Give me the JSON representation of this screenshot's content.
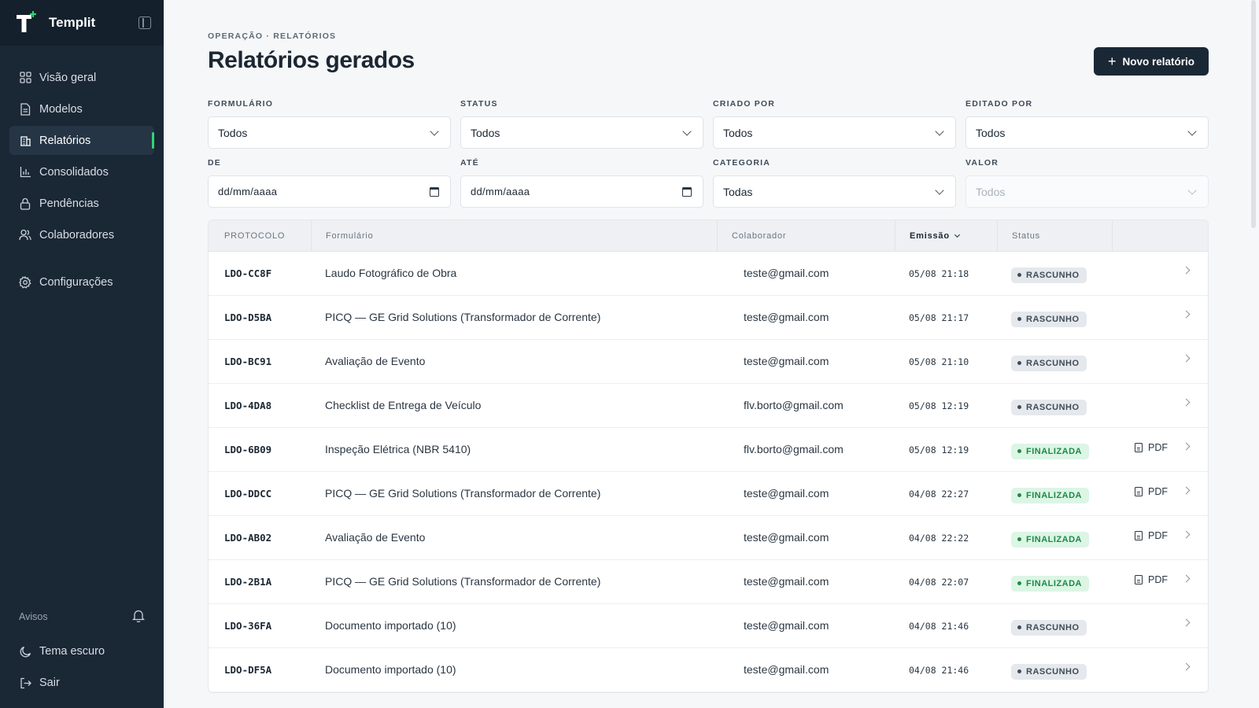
{
  "app": {
    "name": "Templit"
  },
  "sidebar": {
    "items": [
      {
        "label": "Visão geral",
        "icon": "grid-icon"
      },
      {
        "label": "Modelos",
        "icon": "document-icon"
      },
      {
        "label": "Relatórios",
        "icon": "building-icon",
        "active": true
      },
      {
        "label": "Consolidados",
        "icon": "bar-chart-icon"
      },
      {
        "label": "Pendências",
        "icon": "lock-icon"
      },
      {
        "label": "Colaboradores",
        "icon": "users-icon"
      },
      {
        "label": "Configurações",
        "icon": "gear-icon"
      }
    ],
    "avisos_label": "Avisos",
    "dark_theme_label": "Tema escuro",
    "logout_label": "Sair"
  },
  "header": {
    "breadcrumb": "OPERAÇÃO · RELATÓRIOS",
    "title": "Relatórios gerados",
    "new_button": "Novo relatório"
  },
  "filters": {
    "formulario": {
      "label": "FORMULÁRIO",
      "value": "Todos"
    },
    "status": {
      "label": "STATUS",
      "value": "Todos"
    },
    "criado_por": {
      "label": "CRIADO POR",
      "value": "Todos"
    },
    "editado_por": {
      "label": "EDITADO POR",
      "value": "Todos"
    },
    "de": {
      "label": "DE",
      "value": "dd/mm/aaaa"
    },
    "ate": {
      "label": "ATÉ",
      "value": "dd/mm/aaaa"
    },
    "categoria": {
      "label": "CATEGORIA",
      "value": "Todas"
    },
    "valor": {
      "label": "VALOR",
      "value": "Todos",
      "disabled": true
    }
  },
  "table": {
    "columns": {
      "protocolo": "PROTOCOLO",
      "formulario": "Formulário",
      "colaborador": "Colaborador",
      "emissao": "Emissão",
      "status": "Status"
    },
    "pdf_label": "PDF",
    "rows": [
      {
        "protocolo": "LDO-CC8F",
        "formulario": "Laudo Fotográfico de Obra",
        "colaborador": "teste@gmail.com",
        "emissao": "05/08 21:18",
        "status": "RASCUNHO",
        "pdf": false
      },
      {
        "protocolo": "LDO-D5BA",
        "formulario": "PICQ — GE Grid Solutions (Transformador de Corrente)",
        "colaborador": "teste@gmail.com",
        "emissao": "05/08 21:17",
        "status": "RASCUNHO",
        "pdf": false
      },
      {
        "protocolo": "LDO-BC91",
        "formulario": "Avaliação de Evento",
        "colaborador": "teste@gmail.com",
        "emissao": "05/08 21:10",
        "status": "RASCUNHO",
        "pdf": false
      },
      {
        "protocolo": "LDO-4DA8",
        "formulario": "Checklist de Entrega de Veículo",
        "colaborador": "flv.borto@gmail.com",
        "emissao": "05/08 12:19",
        "status": "RASCUNHO",
        "pdf": false
      },
      {
        "protocolo": "LDO-6B09",
        "formulario": "Inspeção Elétrica (NBR 5410)",
        "colaborador": "flv.borto@gmail.com",
        "emissao": "05/08 12:19",
        "status": "FINALIZADA",
        "pdf": true
      },
      {
        "protocolo": "LDO-DDCC",
        "formulario": "PICQ — GE Grid Solutions (Transformador de Corrente)",
        "colaborador": "teste@gmail.com",
        "emissao": "04/08 22:27",
        "status": "FINALIZADA",
        "pdf": true
      },
      {
        "protocolo": "LDO-AB02",
        "formulario": "Avaliação de Evento",
        "colaborador": "teste@gmail.com",
        "emissao": "04/08 22:22",
        "status": "FINALIZADA",
        "pdf": true
      },
      {
        "protocolo": "LDO-2B1A",
        "formulario": "PICQ — GE Grid Solutions (Transformador de Corrente)",
        "colaborador": "teste@gmail.com",
        "emissao": "04/08 22:07",
        "status": "FINALIZADA",
        "pdf": true
      },
      {
        "protocolo": "LDO-36FA",
        "formulario": "Documento importado (10)",
        "colaborador": "teste@gmail.com",
        "emissao": "04/08 21:46",
        "status": "RASCUNHO",
        "pdf": false
      },
      {
        "protocolo": "LDO-DF5A",
        "formulario": "Documento importado (10)",
        "colaborador": "teste@gmail.com",
        "emissao": "04/08 21:46",
        "status": "RASCUNHO",
        "pdf": false
      }
    ]
  },
  "colors": {
    "sidebar_bg": "#1a2735",
    "accent_green": "#2fd673",
    "draft_badge": "#e5e8ec",
    "final_badge": "#dcf5e5"
  }
}
